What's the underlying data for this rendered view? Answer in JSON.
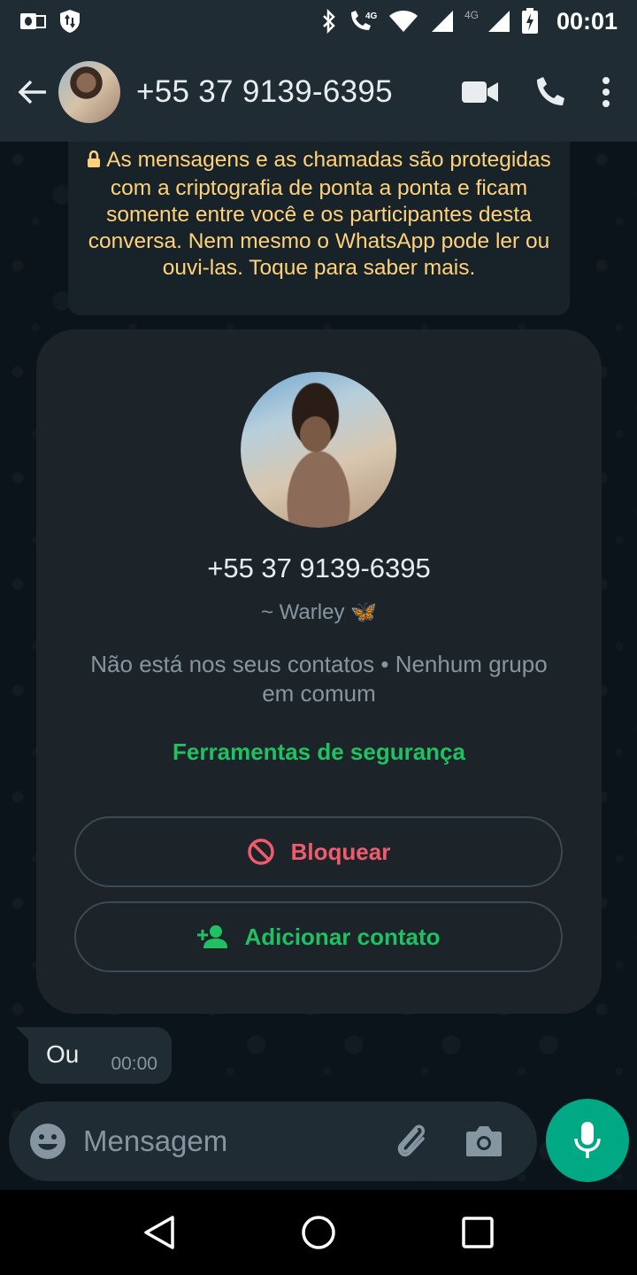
{
  "status_bar": {
    "time": "00:01",
    "network_label_1": "4G",
    "network_label_2": "4G",
    "icons": [
      "outlook-icon",
      "vpn-shield-icon",
      "bluetooth-icon",
      "volte-call-icon",
      "wifi-icon",
      "signal-icon",
      "signal-icon",
      "battery-charging-icon"
    ]
  },
  "header": {
    "title": "+55 37 9139-6395",
    "icons": [
      "back-arrow-icon",
      "video-call-icon",
      "voice-call-icon",
      "more-options-icon"
    ]
  },
  "encryption_notice": {
    "text": "As mensagens e as chamadas são protegidas com a criptografia de ponta a ponta e ficam somente entre você e os participantes desta conversa. Nem mesmo o WhatsApp pode ler ou ouvi-las. Toque para saber mais."
  },
  "profile_card": {
    "phone": "+55 37 9139-6395",
    "push_name": "~ Warley 🦋",
    "info": "Não está nos seus contatos • Nenhum grupo em comum",
    "safety_tools": "Ferramentas de segurança",
    "block_label": "Bloquear",
    "add_contact_label": "Adicionar contato"
  },
  "messages": [
    {
      "text": "Ou",
      "time": "00:00",
      "direction": "incoming"
    }
  ],
  "composer": {
    "placeholder": "Mensagem"
  },
  "colors": {
    "accent_green": "#21c063",
    "fab_green": "#00a884",
    "block_red": "#f15c6d",
    "notice_yellow": "#ffd279",
    "header_bg": "#1f2c34",
    "chat_bg": "#0b141a"
  }
}
